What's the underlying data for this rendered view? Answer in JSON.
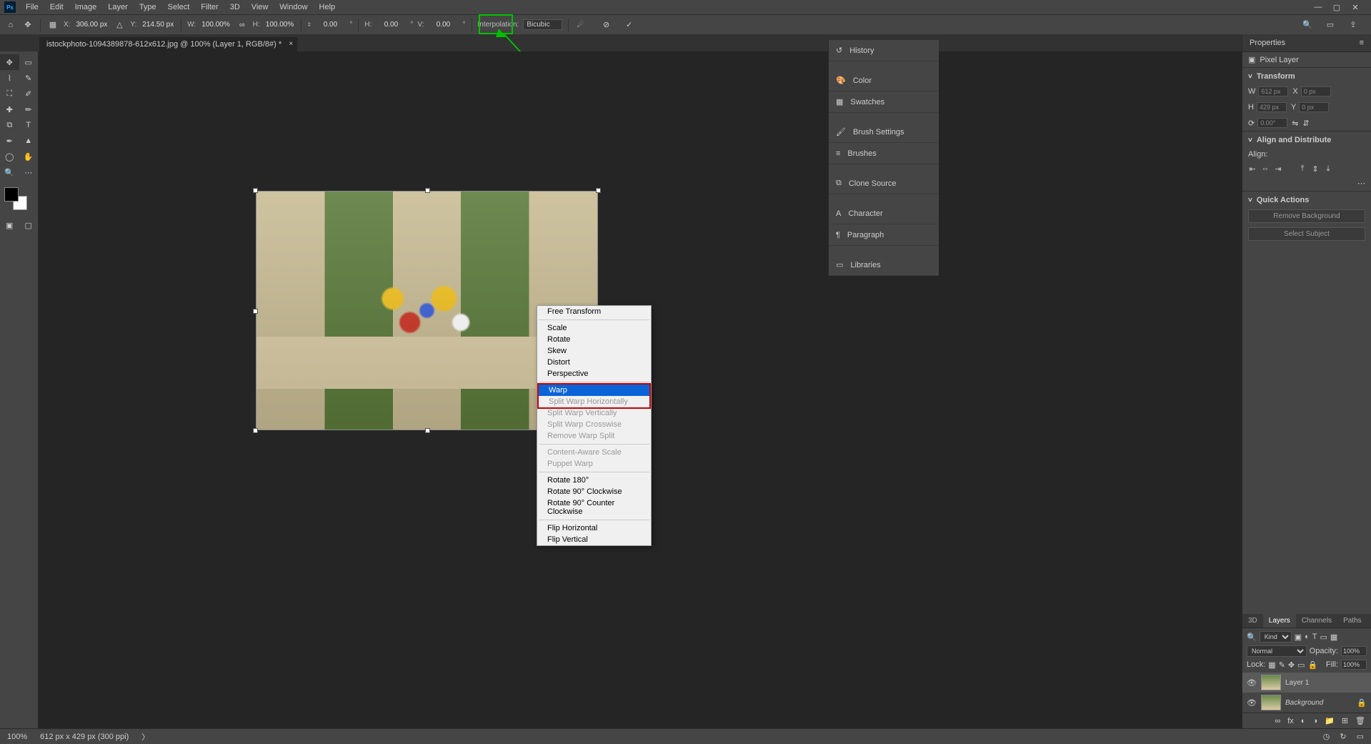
{
  "menubar": [
    "File",
    "Edit",
    "Image",
    "Layer",
    "Type",
    "Select",
    "Filter",
    "3D",
    "View",
    "Window",
    "Help"
  ],
  "optbar": {
    "x_label": "X:",
    "x": "306.00 px",
    "y_label": "Y:",
    "y": "214.50 px",
    "w_label": "W:",
    "w": "100.00%",
    "h_label": "H:",
    "h": "100.00%",
    "angle_label": "⧧",
    "angle": "0.00",
    "skew_h_label": "H:",
    "skew_h": "0.00",
    "skew_v_label": "V:",
    "skew_v": "0.00",
    "interp_label": "Interpolation:",
    "interp": "Bicubic"
  },
  "warp_callout": "Warp button",
  "tab": {
    "title": "istockphoto-1094389878-612x612.jpg @ 100% (Layer 1, RGB/8#) *"
  },
  "ctx": {
    "free_transform": "Free Transform",
    "scale": "Scale",
    "rotate": "Rotate",
    "skew": "Skew",
    "distort": "Distort",
    "perspective": "Perspective",
    "warp": "Warp",
    "split_h": "Split Warp Horizontally",
    "split_v": "Split Warp Vertically",
    "split_c": "Split Warp Crosswise",
    "remove_split": "Remove Warp Split",
    "cas": "Content-Aware Scale",
    "puppet": "Puppet Warp",
    "r180": "Rotate 180°",
    "r90cw": "Rotate 90° Clockwise",
    "r90ccw": "Rotate 90° Counter Clockwise",
    "flip_h": "Flip Horizontal",
    "flip_v": "Flip Vertical"
  },
  "mid_panels": [
    "History",
    "Color",
    "Swatches",
    "Brush Settings",
    "Brushes",
    "Clone Source",
    "Character",
    "Paragraph",
    "Libraries"
  ],
  "properties": {
    "title": "Properties",
    "layer_type": "Pixel Layer",
    "transform_hdr": "Transform",
    "w": "612 px",
    "h": "429 px",
    "x": "0 px",
    "y": "0 px",
    "rot": "0.00°",
    "align_hdr": "Align and Distribute",
    "align_label": "Align:",
    "quick_hdr": "Quick Actions",
    "remove_bg": "Remove Background",
    "select_subj": "Select Subject"
  },
  "layers": {
    "tabs": [
      "3D",
      "Layers",
      "Channels",
      "Paths"
    ],
    "kind": "Kind",
    "mode": "Normal",
    "opacity_label": "Opacity:",
    "opacity": "100%",
    "lock_label": "Lock:",
    "fill_label": "Fill:",
    "fill": "100%",
    "items": [
      {
        "name": "Layer 1",
        "italic": false
      },
      {
        "name": "Background",
        "italic": true
      }
    ]
  },
  "status": {
    "zoom": "100%",
    "dims": "612 px x 429 px (300 ppi)"
  }
}
